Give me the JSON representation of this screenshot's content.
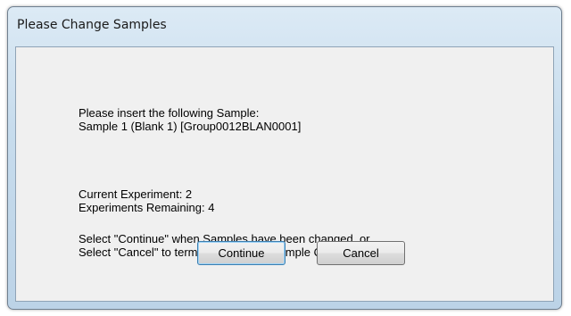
{
  "window": {
    "title": "Please Change Samples"
  },
  "message": {
    "insert_line1": "Please insert the following Sample:",
    "insert_line2": "Sample 1 (Blank 1) [Group0012BLAN0001]",
    "current_experiment": "Current Experiment: 2",
    "experiments_remaining": "Experiments Remaining: 4",
    "instruction_line1": "Select \"Continue\" when Samples have been changed, or",
    "instruction_line2": "Select \"Cancel\" to terminate Aqualog Sample Q testing."
  },
  "buttons": {
    "continue_label": "Continue",
    "cancel_label": "Cancel"
  },
  "colors": {
    "frame": "#c7dced",
    "client_background": "#f0f0f0",
    "default_button_border": "#3c7fb1"
  }
}
